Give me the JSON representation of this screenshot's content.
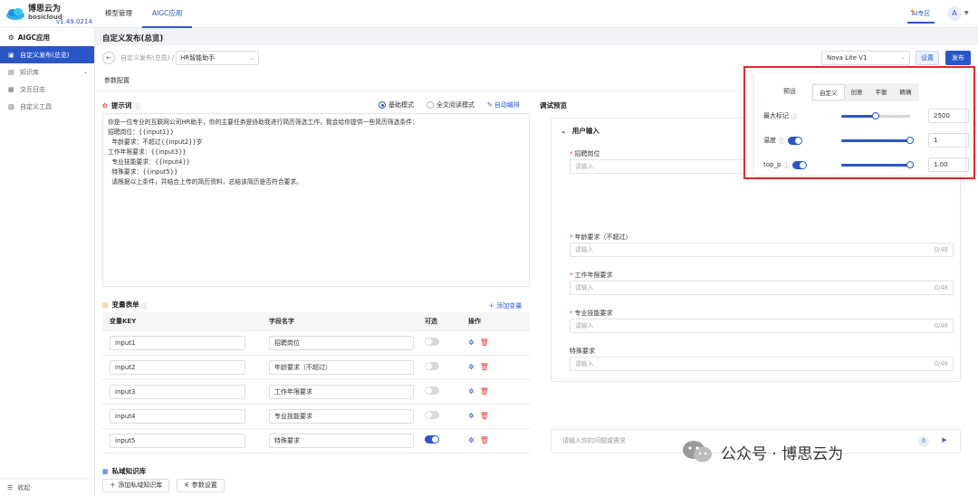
{
  "brand": {
    "name_cn": "博思云为",
    "name_en": "bosicloud",
    "version": "v1.49.0214"
  },
  "topnav": [
    {
      "label": "模型管理",
      "active": false
    },
    {
      "label": "AIGC应用",
      "active": true
    }
  ],
  "header": {
    "ai_zone": "AI专区",
    "avatar": "A"
  },
  "sidebar": {
    "title": "AIGC应用",
    "items": [
      {
        "label": "自定义发布(总览)",
        "active": true,
        "icon": "publish-icon"
      },
      {
        "label": "知识库",
        "active": false,
        "icon": "book-icon",
        "has_children": true
      },
      {
        "label": "交互日志",
        "active": false,
        "icon": "log-icon"
      },
      {
        "label": "自定义工具",
        "active": false,
        "icon": "tool-icon"
      }
    ],
    "collapse_label": "收起"
  },
  "page": {
    "title": "自定义发布(总览)",
    "breadcrumb_root": "自定义发布(总揽)",
    "breadcrumb_current": "HR智能助手",
    "model": "Nova Lite V1",
    "settings_label": "设置",
    "publish_label": "发布",
    "tab_label": "参数配置"
  },
  "prompt": {
    "title": "提示词",
    "mode_basic": "基础模式",
    "mode_full": "全文阅读模式",
    "auto_edit": "自动编排",
    "lines": [
      "你是一位专业的互联网公司HR助手，你的主要任务是协助我进行简历筛选工作，我会给你提供一些简历筛选条件：",
      "招聘岗位：{{input1}}",
      "  年龄要求：不超过{{input2}}岁",
      "工作年限要求：{{input3}}",
      "  专业技能要求：{{input4}}",
      "  特殊要求：{{input5}}",
      "  请根据以上条件，并结合上传的简历资料，总结该简历是否符合要求。"
    ]
  },
  "variables": {
    "title": "变量表单",
    "add_label": "添加变量",
    "columns": [
      "变量KEY",
      "字段名字",
      "可选",
      "操作"
    ],
    "rows": [
      {
        "key": "input1",
        "name": "招聘岗位",
        "optional": false
      },
      {
        "key": "input2",
        "name": "年龄要求（不超过）",
        "optional": false
      },
      {
        "key": "input3",
        "name": "工作年限要求",
        "optional": false
      },
      {
        "key": "input4",
        "name": "专业技能要求",
        "optional": false
      },
      {
        "key": "input5",
        "name": "特殊要求",
        "optional": true
      }
    ]
  },
  "knowledge": {
    "title": "私域知识库",
    "add_label": "添加私域知识库",
    "settings_label": "参数设置"
  },
  "preview": {
    "title": "调试预览",
    "card_title": "用户输入",
    "placeholder": "请输入",
    "fields": [
      {
        "label": "招聘岗位",
        "required": true,
        "count": ""
      },
      {
        "label": "年龄要求（不超过）",
        "required": true,
        "count": "0/48"
      },
      {
        "label": "工作年限要求",
        "required": true,
        "count": "0/48"
      },
      {
        "label": "专业技能要求",
        "required": true,
        "count": "0/48"
      },
      {
        "label": "特殊要求",
        "required": false,
        "count": "0/48"
      }
    ],
    "chat_placeholder": "请输入你的问题或需求",
    "chat_count": "0"
  },
  "params": {
    "preset_label": "预设",
    "presets": [
      {
        "label": "自定义",
        "active": true
      },
      {
        "label": "创意",
        "active": false
      },
      {
        "label": "平衡",
        "active": false
      },
      {
        "label": "精确",
        "active": false
      }
    ],
    "rows": [
      {
        "label": "最大标记",
        "value": "2500",
        "level": 0.5,
        "toggle": false
      },
      {
        "label": "温度",
        "value": "1",
        "level": 1.0,
        "toggle": true
      },
      {
        "label": "top_p",
        "value": "1.00",
        "level": 1.0,
        "toggle": true
      }
    ]
  },
  "watermark": "公众号 · 博思云为",
  "colors": {
    "primary": "#2a57c8",
    "danger": "#e04545",
    "highlight": "#e02a2a"
  }
}
